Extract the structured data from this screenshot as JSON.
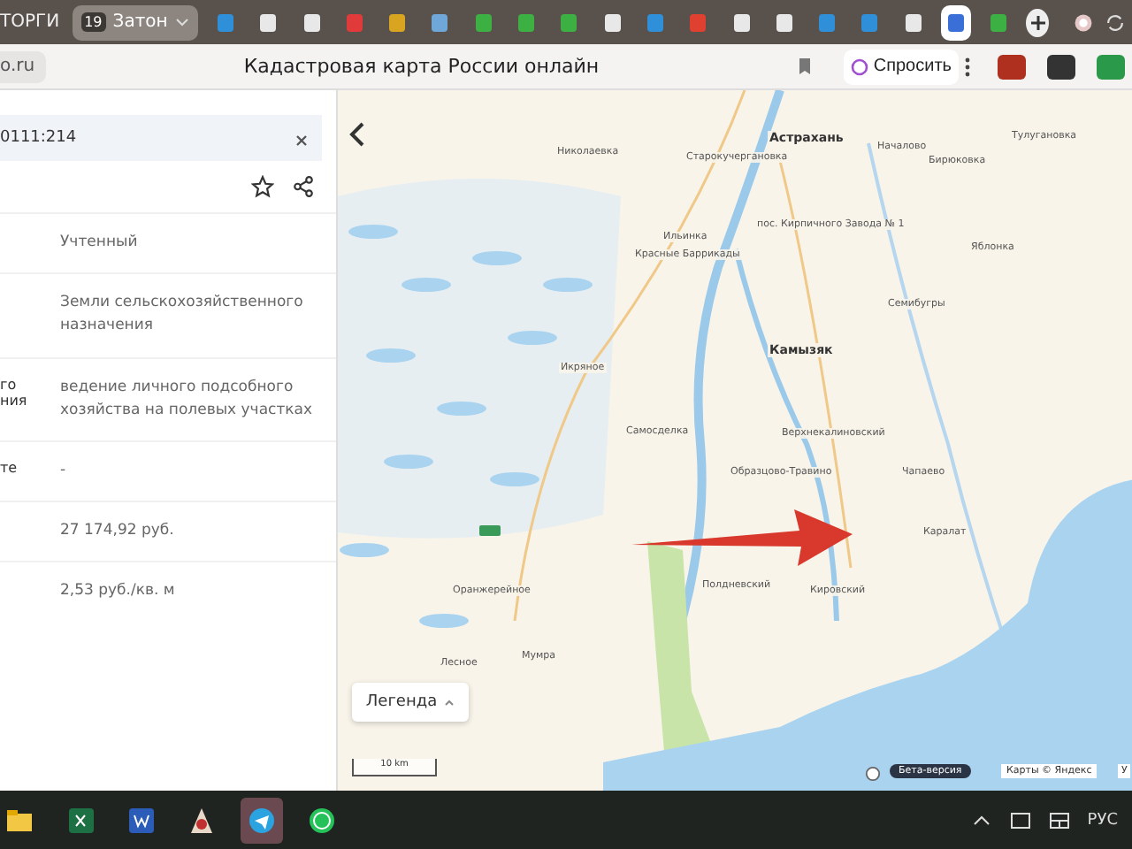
{
  "browser": {
    "tabs": [
      {
        "kind": "text",
        "label": "ТОРГИ",
        "selected": false
      },
      {
        "kind": "group",
        "label": "Затон",
        "badge": "19",
        "selected": false
      },
      {
        "kind": "favicon",
        "color": "#2f8fd8",
        "selected": false
      },
      {
        "kind": "favicon",
        "color": "#e8e8e8",
        "selected": false
      },
      {
        "kind": "favicon",
        "color": "#e8e8e8",
        "selected": false
      },
      {
        "kind": "favicon",
        "color": "#e03a3a",
        "selected": false
      },
      {
        "kind": "favicon",
        "color": "#d9a520",
        "selected": false
      },
      {
        "kind": "favicon",
        "color": "#6fa8d8",
        "selected": false
      },
      {
        "kind": "favicon",
        "color": "#3cb043",
        "selected": false
      },
      {
        "kind": "favicon",
        "color": "#3cb043",
        "selected": false
      },
      {
        "kind": "favicon",
        "color": "#3cb043",
        "selected": false
      },
      {
        "kind": "favicon",
        "color": "#e8e8e8",
        "selected": false
      },
      {
        "kind": "favicon",
        "color": "#2f8fd8",
        "selected": false
      },
      {
        "kind": "favicon",
        "color": "#e04030",
        "selected": false
      },
      {
        "kind": "favicon",
        "color": "#e8e8e8",
        "selected": false
      },
      {
        "kind": "favicon",
        "color": "#e8e8e8",
        "selected": false
      },
      {
        "kind": "favicon",
        "color": "#2f8fd8",
        "selected": false
      },
      {
        "kind": "favicon",
        "color": "#2f8fd8",
        "selected": false
      },
      {
        "kind": "favicon",
        "color": "#e8e8e8",
        "selected": false
      },
      {
        "kind": "favicon",
        "color": "#3a6fd8",
        "selected": true
      },
      {
        "kind": "favicon",
        "color": "#3cb043",
        "selected": false
      }
    ],
    "address": "o.ru",
    "page_title": "Кадастровая карта России онлайн",
    "ask_button": "Спросить"
  },
  "panel": {
    "search_value": "0111:214",
    "rows": [
      {
        "label": "",
        "value": "Учтенный"
      },
      {
        "label": "",
        "value": "Земли сельскохозяйственного назначения"
      },
      {
        "label": "го\nния",
        "value": "ведение личного подсобного хозяйства на полевых участках"
      },
      {
        "label": "те",
        "value": "-"
      },
      {
        "label": "",
        "value": "27 174,92 руб."
      },
      {
        "label": "",
        "value": "2,53 руб./кв. м"
      }
    ]
  },
  "map": {
    "labels": [
      {
        "text": "Астрахань",
        "kind": "city"
      },
      {
        "text": "Началово",
        "kind": "town"
      },
      {
        "text": "Старокучергановка",
        "kind": "town"
      },
      {
        "text": "Николаевка",
        "kind": "town"
      },
      {
        "text": "Бирюковка",
        "kind": "town"
      },
      {
        "text": "Тулугановка",
        "kind": "town"
      },
      {
        "text": "Ильинка",
        "kind": "town"
      },
      {
        "text": "Красные Баррикады",
        "kind": "town"
      },
      {
        "text": "пос. Кирпичного Завода № 1",
        "kind": "town"
      },
      {
        "text": "Яблонка",
        "kind": "town"
      },
      {
        "text": "Камызяк",
        "kind": "city"
      },
      {
        "text": "Икряное",
        "kind": "town"
      },
      {
        "text": "Семибугры",
        "kind": "town"
      },
      {
        "text": "Самосделка",
        "kind": "town"
      },
      {
        "text": "Верхнекалиновский",
        "kind": "town"
      },
      {
        "text": "Образцово-Травино",
        "kind": "town"
      },
      {
        "text": "Чапаево",
        "kind": "town"
      },
      {
        "text": "Каралат",
        "kind": "town"
      },
      {
        "text": "Полдневский",
        "kind": "town"
      },
      {
        "text": "Кировский",
        "kind": "town"
      },
      {
        "text": "Оранжерейное",
        "kind": "town"
      },
      {
        "text": "Мумра",
        "kind": "town"
      },
      {
        "text": "Лесное",
        "kind": "town"
      }
    ],
    "legend_button": "Легенда",
    "scale": "10 km",
    "beta_badge": "Бета-версия",
    "attribution": "Карты © Яндекс",
    "attribution_cut": "У"
  },
  "taskbar": {
    "apps": [
      {
        "kind": "folder",
        "selected": false
      },
      {
        "kind": "excel",
        "selected": false
      },
      {
        "kind": "word",
        "selected": false
      },
      {
        "kind": "app",
        "selected": false
      },
      {
        "kind": "telegram",
        "selected": true
      },
      {
        "kind": "whatsapp",
        "selected": false
      }
    ],
    "language": "РУС"
  }
}
